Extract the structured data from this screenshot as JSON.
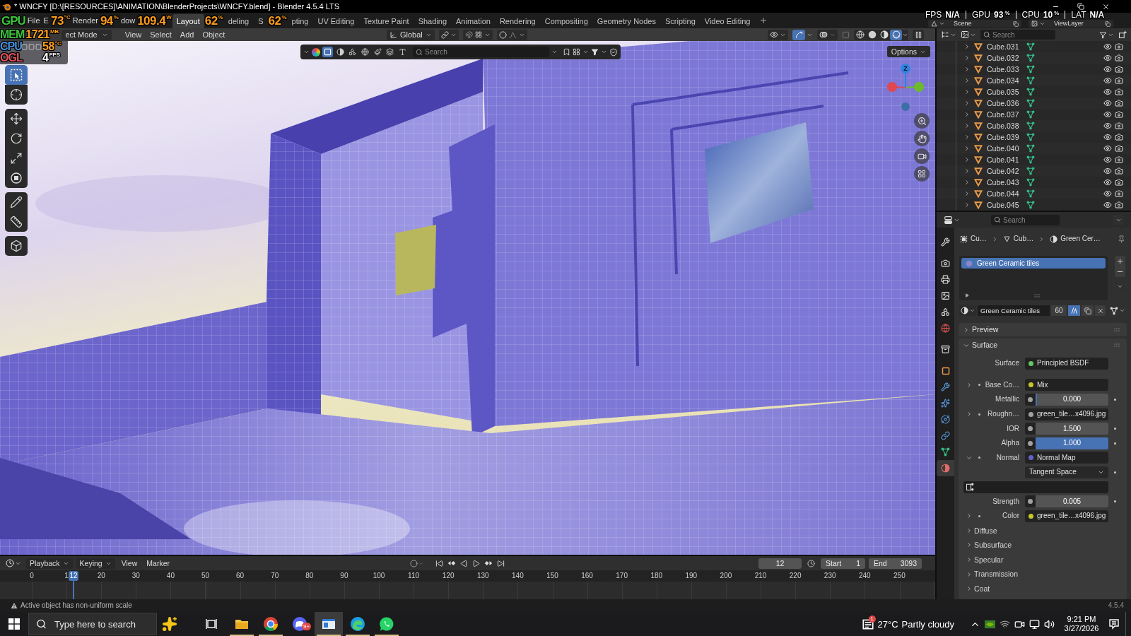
{
  "window": {
    "title": "* WNCFY [D:\\[RESOURCES]\\ANIMATION\\BlenderProjects\\WNCFY.blend] - Blender 4.5.4 LTS"
  },
  "stats_overlay": [
    {
      "label": "FPS",
      "value": "N/A"
    },
    {
      "label": "GPU",
      "value": "93",
      "unit": "%"
    },
    {
      "label": "CPU",
      "value": "10",
      "unit": "%"
    },
    {
      "label": "LAT",
      "value": "N/A"
    }
  ],
  "top_bar": {
    "items": [
      {
        "kind": "hud_label",
        "text": "GPU",
        "color": "#3cc23c"
      },
      {
        "kind": "menu",
        "text": "File"
      },
      {
        "kind": "menu",
        "text": "E"
      },
      {
        "kind": "hud_value",
        "text": "73",
        "unit": "°C",
        "color": "#ff9d1c"
      },
      {
        "kind": "menu",
        "text": "Render"
      },
      {
        "kind": "hud_value",
        "text": "94",
        "unit": "%",
        "color": "#ff9d1c"
      },
      {
        "kind": "menu",
        "text": "dow"
      },
      {
        "kind": "hud_value",
        "text": "109.4",
        "unit": "W",
        "color": "#ff9d1c"
      },
      {
        "kind": "tab",
        "text": "Layout",
        "selected": true
      },
      {
        "kind": "hud_value",
        "text": "62",
        "unit": "%",
        "color": "#ff9d1c"
      },
      {
        "kind": "tab",
        "text": "deling",
        "selected": false
      },
      {
        "kind": "tab",
        "text": "S",
        "selected": false
      },
      {
        "kind": "hud_value",
        "text": "62",
        "unit": "%",
        "color": "#ff9d1c"
      },
      {
        "kind": "tab",
        "text": "pting",
        "selected": false
      },
      {
        "kind": "tab",
        "text": "UV Editing",
        "selected": false
      },
      {
        "kind": "tab",
        "text": "Texture Paint",
        "selected": false
      },
      {
        "kind": "tab",
        "text": "Shading",
        "selected": false
      },
      {
        "kind": "tab",
        "text": "Animation",
        "selected": false
      },
      {
        "kind": "tab",
        "text": "Rendering",
        "selected": false
      },
      {
        "kind": "tab",
        "text": "Compositing",
        "selected": false
      },
      {
        "kind": "tab",
        "text": "Geometry Nodes",
        "selected": false
      },
      {
        "kind": "tab",
        "text": "Scripting",
        "selected": false
      },
      {
        "kind": "tab",
        "text": "Video Editing",
        "selected": false
      }
    ],
    "scene": "Scene",
    "view_layer": "ViewLayer"
  },
  "viewport": {
    "header": {
      "items": [
        {
          "kind": "hud_label",
          "text": "MEM",
          "color": "#3cc23c"
        },
        {
          "kind": "hud_value",
          "text": "1721",
          "unit": "MB",
          "color": "#ff9d1c"
        },
        {
          "kind": "dropdown",
          "text": "ect Mode"
        },
        {
          "kind": "menu",
          "text": "View"
        },
        {
          "kind": "menu",
          "text": "Select"
        },
        {
          "kind": "menu",
          "text": "Add"
        },
        {
          "kind": "menu",
          "text": "Object"
        }
      ],
      "orientation": "Global",
      "gizmos": {
        "on": true
      },
      "shading": [
        {
          "kind": "wireframe",
          "selected": false
        },
        {
          "kind": "solid",
          "selected": false
        },
        {
          "kind": "material",
          "selected": false
        },
        {
          "kind": "rendered",
          "selected": true
        }
      ]
    },
    "hud": [
      {
        "kind": "hud_label",
        "text": "CPU",
        "color": "#3d8fe0"
      },
      {
        "kind": "hud_value",
        "text": "58",
        "unit": "°C",
        "color": "#ff9d1c"
      },
      {
        "kind": "hud_label",
        "text": "OGL",
        "color": "#e0505a"
      },
      {
        "kind": "hud_value",
        "text": "4",
        "unit": "FPS",
        "color": "#ffffff"
      }
    ],
    "asset_bar": {
      "filters": [
        {
          "kind": "object",
          "selected": true
        },
        {
          "kind": "material",
          "selected": false
        },
        {
          "kind": "node",
          "selected": false
        },
        {
          "kind": "world",
          "selected": false
        },
        {
          "kind": "brush",
          "selected": false
        },
        {
          "kind": "scene",
          "selected": false
        },
        {
          "kind": "text",
          "selected": false
        }
      ],
      "search": {
        "placeholder": "Search"
      }
    },
    "options": "Options",
    "tool_groups": [
      {
        "tools": [
          {
            "kind": "select",
            "selected": true
          },
          {
            "kind": "cursor",
            "selected": false
          }
        ]
      },
      {
        "tools": [
          {
            "kind": "move",
            "selected": false
          },
          {
            "kind": "rotate",
            "selected": false
          },
          {
            "kind": "scale",
            "selected": false
          },
          {
            "kind": "transform",
            "selected": false
          }
        ]
      },
      {
        "tools": [
          {
            "kind": "annotate",
            "selected": false
          },
          {
            "kind": "measure",
            "selected": false
          }
        ]
      },
      {
        "tools": [
          {
            "kind": "add_cube",
            "selected": false
          }
        ]
      }
    ],
    "gizmo": {
      "z_label": "Z"
    }
  },
  "outliner": {
    "search": {
      "placeholder": "Search"
    },
    "rows": [
      {
        "name": "Cube.031",
        "expanded": false,
        "visible": true
      },
      {
        "name": "Cube.032",
        "expanded": false,
        "visible": true
      },
      {
        "name": "Cube.033",
        "expanded": false,
        "visible": true
      },
      {
        "name": "Cube.034",
        "expanded": false,
        "visible": true
      },
      {
        "name": "Cube.035",
        "expanded": false,
        "visible": true
      },
      {
        "name": "Cube.036",
        "expanded": false,
        "visible": true
      },
      {
        "name": "Cube.037",
        "expanded": false,
        "visible": true
      },
      {
        "name": "Cube.038",
        "expanded": false,
        "visible": true
      },
      {
        "name": "Cube.039",
        "expanded": false,
        "visible": true
      },
      {
        "name": "Cube.040",
        "expanded": false,
        "visible": true
      },
      {
        "name": "Cube.041",
        "expanded": false,
        "visible": true
      },
      {
        "name": "Cube.042",
        "expanded": false,
        "visible": true
      },
      {
        "name": "Cube.043",
        "expanded": false,
        "visible": true
      },
      {
        "name": "Cube.044",
        "expanded": false,
        "visible": true
      },
      {
        "name": "Cube.045",
        "expanded": false,
        "visible": true
      }
    ]
  },
  "properties": {
    "search": {
      "placeholder": "Search"
    },
    "tab_groups": [
      {
        "tabs": [
          {
            "kind": "tool",
            "selected": false
          }
        ]
      },
      {
        "tabs": [
          {
            "kind": "render",
            "selected": false
          },
          {
            "kind": "output",
            "selected": false
          },
          {
            "kind": "view_layer",
            "selected": false
          },
          {
            "kind": "scene",
            "selected": false
          },
          {
            "kind": "world",
            "selected": false
          }
        ]
      },
      {
        "tabs": [
          {
            "kind": "collection",
            "selected": false
          }
        ]
      },
      {
        "tabs": [
          {
            "kind": "object",
            "selected": false
          },
          {
            "kind": "modifiers",
            "selected": false
          },
          {
            "kind": "particles",
            "selected": false
          },
          {
            "kind": "physics",
            "selected": false
          },
          {
            "kind": "constraints",
            "selected": false
          },
          {
            "kind": "data",
            "selected": false
          },
          {
            "kind": "material",
            "selected": true
          }
        ]
      }
    ],
    "breadcrumb": [
      "Cu…",
      "Cub…",
      "Green Cer…"
    ],
    "material_slots": [
      {
        "name": "Green Ceramic tiles",
        "selected": true
      }
    ],
    "material": {
      "name": "Green Ceramic tiles",
      "users": "60",
      "fake_user": true
    },
    "panels": [
      {
        "title": "Preview",
        "expanded": false
      },
      {
        "title": "Surface",
        "expanded": true,
        "shader": {
          "label": "Surface",
          "value": "Principled BSDF",
          "color": "#63c763"
        },
        "inputs": [
          {
            "kind": "link",
            "label": "Base Co…",
            "value": "Mix",
            "color": "#c7c729",
            "expanded": false
          },
          {
            "kind": "slider",
            "label": "Metallic",
            "value": "0.000",
            "level": 0,
            "color": "#a1a1a1"
          },
          {
            "kind": "link",
            "label": "Roughn…",
            "value": "green_tile…x4096.jpg",
            "color": "#a1a1a1",
            "expanded": false
          },
          {
            "kind": "number",
            "label": "IOR",
            "value": "1.500",
            "color": "#a1a1a1"
          },
          {
            "kind": "slider",
            "label": "Alpha",
            "value": "1.000",
            "level": 1,
            "color": "#a1a1a1"
          },
          {
            "kind": "link",
            "label": "Normal",
            "value": "Normal Map",
            "color": "#6363c7",
            "expanded": true
          },
          {
            "kind": "enum",
            "value": "Tangent Space"
          },
          {
            "kind": "uv_map"
          },
          {
            "kind": "number",
            "label": "Strength",
            "value": "0.005",
            "color": "#a1a1a1"
          },
          {
            "kind": "link",
            "label": "Color",
            "value": "green_tile…x4096.jpg",
            "color": "#c7c729",
            "expanded": false
          },
          {
            "kind": "subpanel",
            "label": "Diffuse",
            "expanded": false
          },
          {
            "kind": "subpanel",
            "label": "Subsurface",
            "expanded": false
          },
          {
            "kind": "subpanel",
            "label": "Specular",
            "expanded": false
          },
          {
            "kind": "subpanel",
            "label": "Transmission",
            "expanded": false
          },
          {
            "kind": "subpanel",
            "label": "Coat",
            "expanded": false
          }
        ]
      }
    ]
  },
  "timeline": {
    "menus": [
      {
        "kind": "dropdown",
        "text": "Playback"
      },
      {
        "kind": "dropdown",
        "text": "Keying"
      },
      {
        "kind": "menu",
        "text": "View"
      },
      {
        "kind": "menu",
        "text": "Marker"
      }
    ],
    "current_frame": "12",
    "start": {
      "label": "Start",
      "value": "1"
    },
    "end": {
      "label": "End",
      "value": "3093"
    },
    "ruler": [
      "0",
      "1",
      "20",
      "30",
      "40",
      "50",
      "60",
      "70",
      "80",
      "90",
      "100",
      "110",
      "120",
      "130",
      "140",
      "150",
      "160",
      "170",
      "180",
      "190",
      "200",
      "210",
      "220",
      "230",
      "240",
      "250"
    ],
    "playhead": "12"
  },
  "status_bar": {
    "message": "Active object has non-uniform scale",
    "version": "4.5.4"
  },
  "taskbar": {
    "search": {
      "placeholder": "Type here to search"
    },
    "apps": [
      {
        "kind": "folder",
        "running": true,
        "active": false
      },
      {
        "kind": "tricolor",
        "running": true,
        "active": false
      },
      {
        "kind": "gamepad",
        "running": false,
        "active": false,
        "badge": "9+"
      },
      {
        "kind": "window",
        "running": true,
        "active": true
      },
      {
        "kind": "swirl",
        "running": true,
        "active": false
      },
      {
        "kind": "bubble",
        "running": true,
        "active": false
      }
    ],
    "weather": {
      "temperature": "27°C",
      "condition": "Partly cloudy",
      "badge": "1"
    },
    "clock": {
      "time": "9:21 PM",
      "date": "3/27/2026"
    }
  }
}
